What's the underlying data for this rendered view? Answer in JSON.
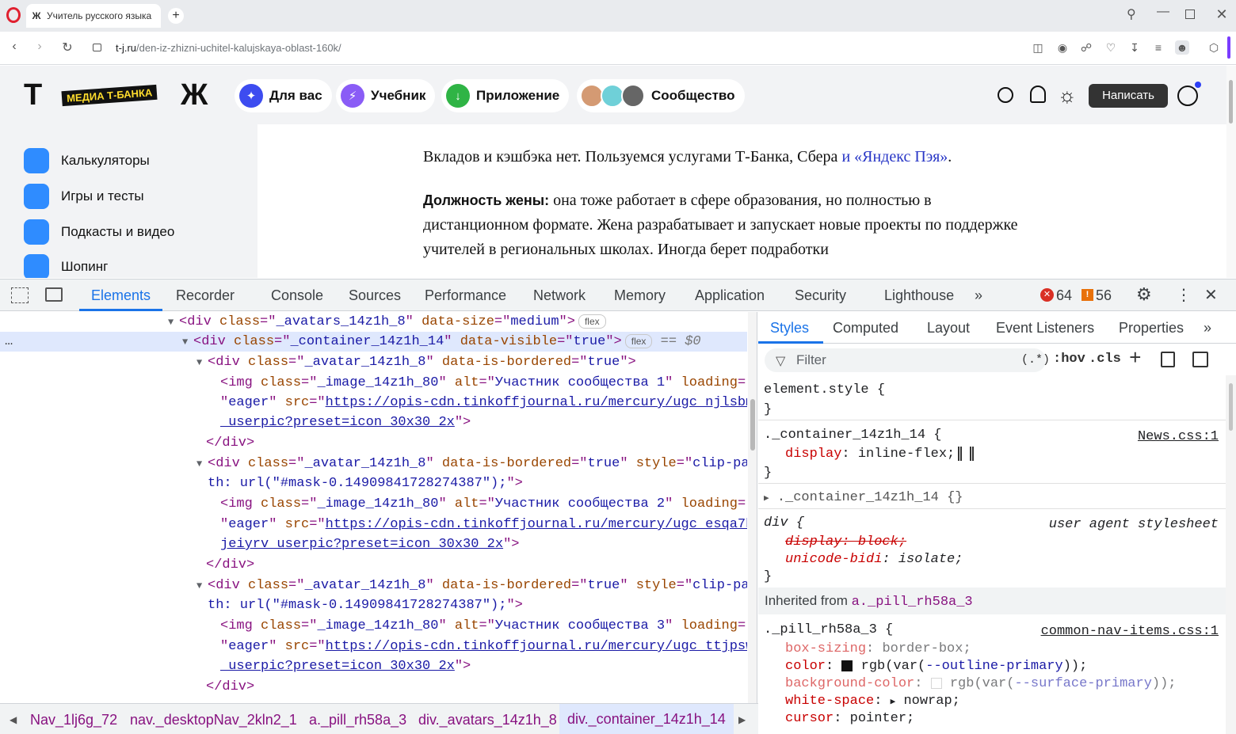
{
  "browser": {
    "tab_title": "Учитель русского языка",
    "url_domain": "t-j.ru",
    "url_path": "/den-iz-zhizni-uchitel-kalujskaya-oblast-160k/"
  },
  "site": {
    "logo_t": "Т",
    "logo_badge": "МЕДИА Т-БАНКА",
    "logo_zh": "Ж",
    "nav": [
      "Для вас",
      "Учебник",
      "Приложение",
      "Сообщество"
    ],
    "write_button": "Написать",
    "sidebar": [
      "Калькуляторы",
      "Игры и тесты",
      "Подкасты и видео",
      "Шопинг"
    ],
    "article": {
      "p1_text": "Вкладов и кэшбэка нет. Пользуемся услугами Т-Банка, Сбера ",
      "p1_link": "и «Яндекс Пэя»",
      "p1_end": ".",
      "p2_label": "Должность жены:",
      "p2_text": " она тоже работает в сфере образования, но полностью в дистанционном формате. Жена разрабатывает и запускает новые проекты по поддержке учителей в региональных школах. Иногда берет подработки"
    }
  },
  "devtools": {
    "tabs": [
      "Elements",
      "Recorder",
      "Console",
      "Sources",
      "Performance",
      "Network",
      "Memory",
      "Application",
      "Security",
      "Lighthouse"
    ],
    "error_count": "64",
    "warning_count": "56",
    "dom": {
      "l1_class": "_avatars_14z1h_8",
      "l1_size": "medium",
      "flex": "flex",
      "l2_class": "_container_14z1h_14",
      "l2_visible": "true",
      "l2_eq": "== $0",
      "avatar_class": "_avatar_14z1h_8",
      "bordered": "true",
      "img_class": "_image_14z1h_80",
      "alt1": "Участник сообщества 1",
      "alt2": "Участник сообщества 2",
      "alt3": "Участник сообщества 3",
      "eager": "eager",
      "src1a": "https://opis-cdn.tinkoffjournal.ru/mercury/ugc_njlsbm",
      "src1b": "_userpic?preset=icon_30x30_2x",
      "src2a": "https://opis-cdn.tinkoffjournal.ru/mercury/ugc_esqa7h",
      "src2b": "jeiyrv_userpic?preset=icon_30x30_2x",
      "src3a": "https://opis-cdn.tinkoffjournal.ru/mercury/ugc_ttjpsw",
      "src3b": "_userpic?preset=icon_30x30_2x",
      "style_a": "clip-pa",
      "style_b": "th: url(\"#mask-0.14909841728274387\");"
    },
    "breadcrumbs": [
      "Nav_1lj6g_72",
      "nav._desktopNav_2kln2_1",
      "a._pill_rh58a_3",
      "div._avatars_14z1h_8",
      "div._container_14z1h_14"
    ],
    "styles": {
      "tabs": [
        "Styles",
        "Computed",
        "Layout",
        "Event Listeners",
        "Properties"
      ],
      "filter_placeholder": "Filter",
      "hov": ":hov",
      "cls": ".cls",
      "regex": "(.*)",
      "element_style": "element.style {",
      "r1_selector": "._container_14z1h_14 {",
      "r1_source": "News.css:1",
      "r1_prop": "display",
      "r1_val": "inline-flex;",
      "r2_selector": "._container_14z1h_14 {}",
      "r3_selector": "div {",
      "r3_source": "user agent stylesheet",
      "r3_prop1": "display: block;",
      "r3_prop2": "unicode-bidi",
      "r3_val2": "isolate;",
      "inherited_label": "Inherited from ",
      "inherited_from": "a._pill_rh58a_3",
      "r4_selector": "._pill_rh58a_3 {",
      "r4_source": "common-nav-items.css:1",
      "r4_p1": "box-sizing",
      "r4_v1": "border-box;",
      "r4_p2": "color",
      "r4_v2a": "rgb(var(",
      "r4_v2b": "--outline-primary",
      "r4_v2c": "));",
      "r4_p3": "background-color",
      "r4_v3a": "rgb(var(",
      "r4_v3b": "--surface-primary",
      "r4_v3c": "));",
      "r4_p4": "white-space",
      "r4_v4": "nowrap;",
      "r4_p5": "cursor",
      "r4_v5": "pointer;"
    }
  }
}
